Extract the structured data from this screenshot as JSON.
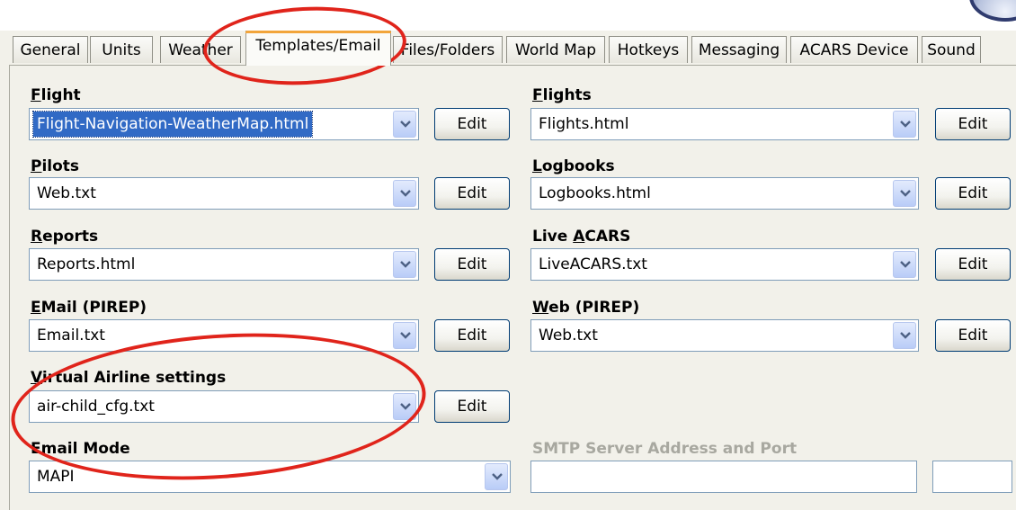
{
  "tabs": [
    {
      "label": "General"
    },
    {
      "label": "Units"
    },
    {
      "label": "Weather"
    },
    {
      "label": "Templates/Email"
    },
    {
      "label": "Files/Folders"
    },
    {
      "label": "World Map"
    },
    {
      "label": "Hotkeys"
    },
    {
      "label": "Messaging"
    },
    {
      "label": "ACARS Device"
    },
    {
      "label": "Sound"
    }
  ],
  "active_tab": "Templates/Email",
  "fields": {
    "flight": {
      "label_mn": "F",
      "label_rest": "light",
      "value": "Flight-Navigation-WeatherMap.html",
      "edit": "Edit"
    },
    "pilots": {
      "label_mn": "P",
      "label_rest": "ilots",
      "value": "Web.txt",
      "edit": "Edit"
    },
    "reports": {
      "label_mn": "R",
      "label_rest": "eports",
      "value": "Reports.html",
      "edit": "Edit"
    },
    "email_pirep": {
      "label_mn": "E",
      "label_rest": "Mail (PIREP)",
      "value": "Email.txt",
      "edit": "Edit"
    },
    "va_settings": {
      "label_mn": "V",
      "label_rest": "irtual Airline settings",
      "value": "air-child_cfg.txt",
      "edit": "Edit"
    },
    "flights": {
      "label_mn": "F",
      "label_rest": "lights",
      "value": "Flights.html",
      "edit": "Edit"
    },
    "logbooks": {
      "label_mn": "L",
      "label_rest": "ogbooks",
      "value": "Logbooks.html",
      "edit": "Edit"
    },
    "live_acars": {
      "label_pre": "Live ",
      "label_mn": "A",
      "label_rest": "CARS",
      "value": "LiveACARS.txt",
      "edit": "Edit"
    },
    "web_pirep": {
      "label_mn": "W",
      "label_rest": "eb (PIREP)",
      "value": "Web.txt",
      "edit": "Edit"
    },
    "email_mode": {
      "label": "Email Mode",
      "value": "MAPI"
    },
    "smtp": {
      "label_pre": "SMTP",
      "label_mn": "",
      "label_rest": " Server Address and Port",
      "address": "",
      "port": ""
    }
  },
  "colors": {
    "annotation": "#e0241b",
    "tab_accent": "#f2a53b",
    "selection": "#316ac5"
  }
}
